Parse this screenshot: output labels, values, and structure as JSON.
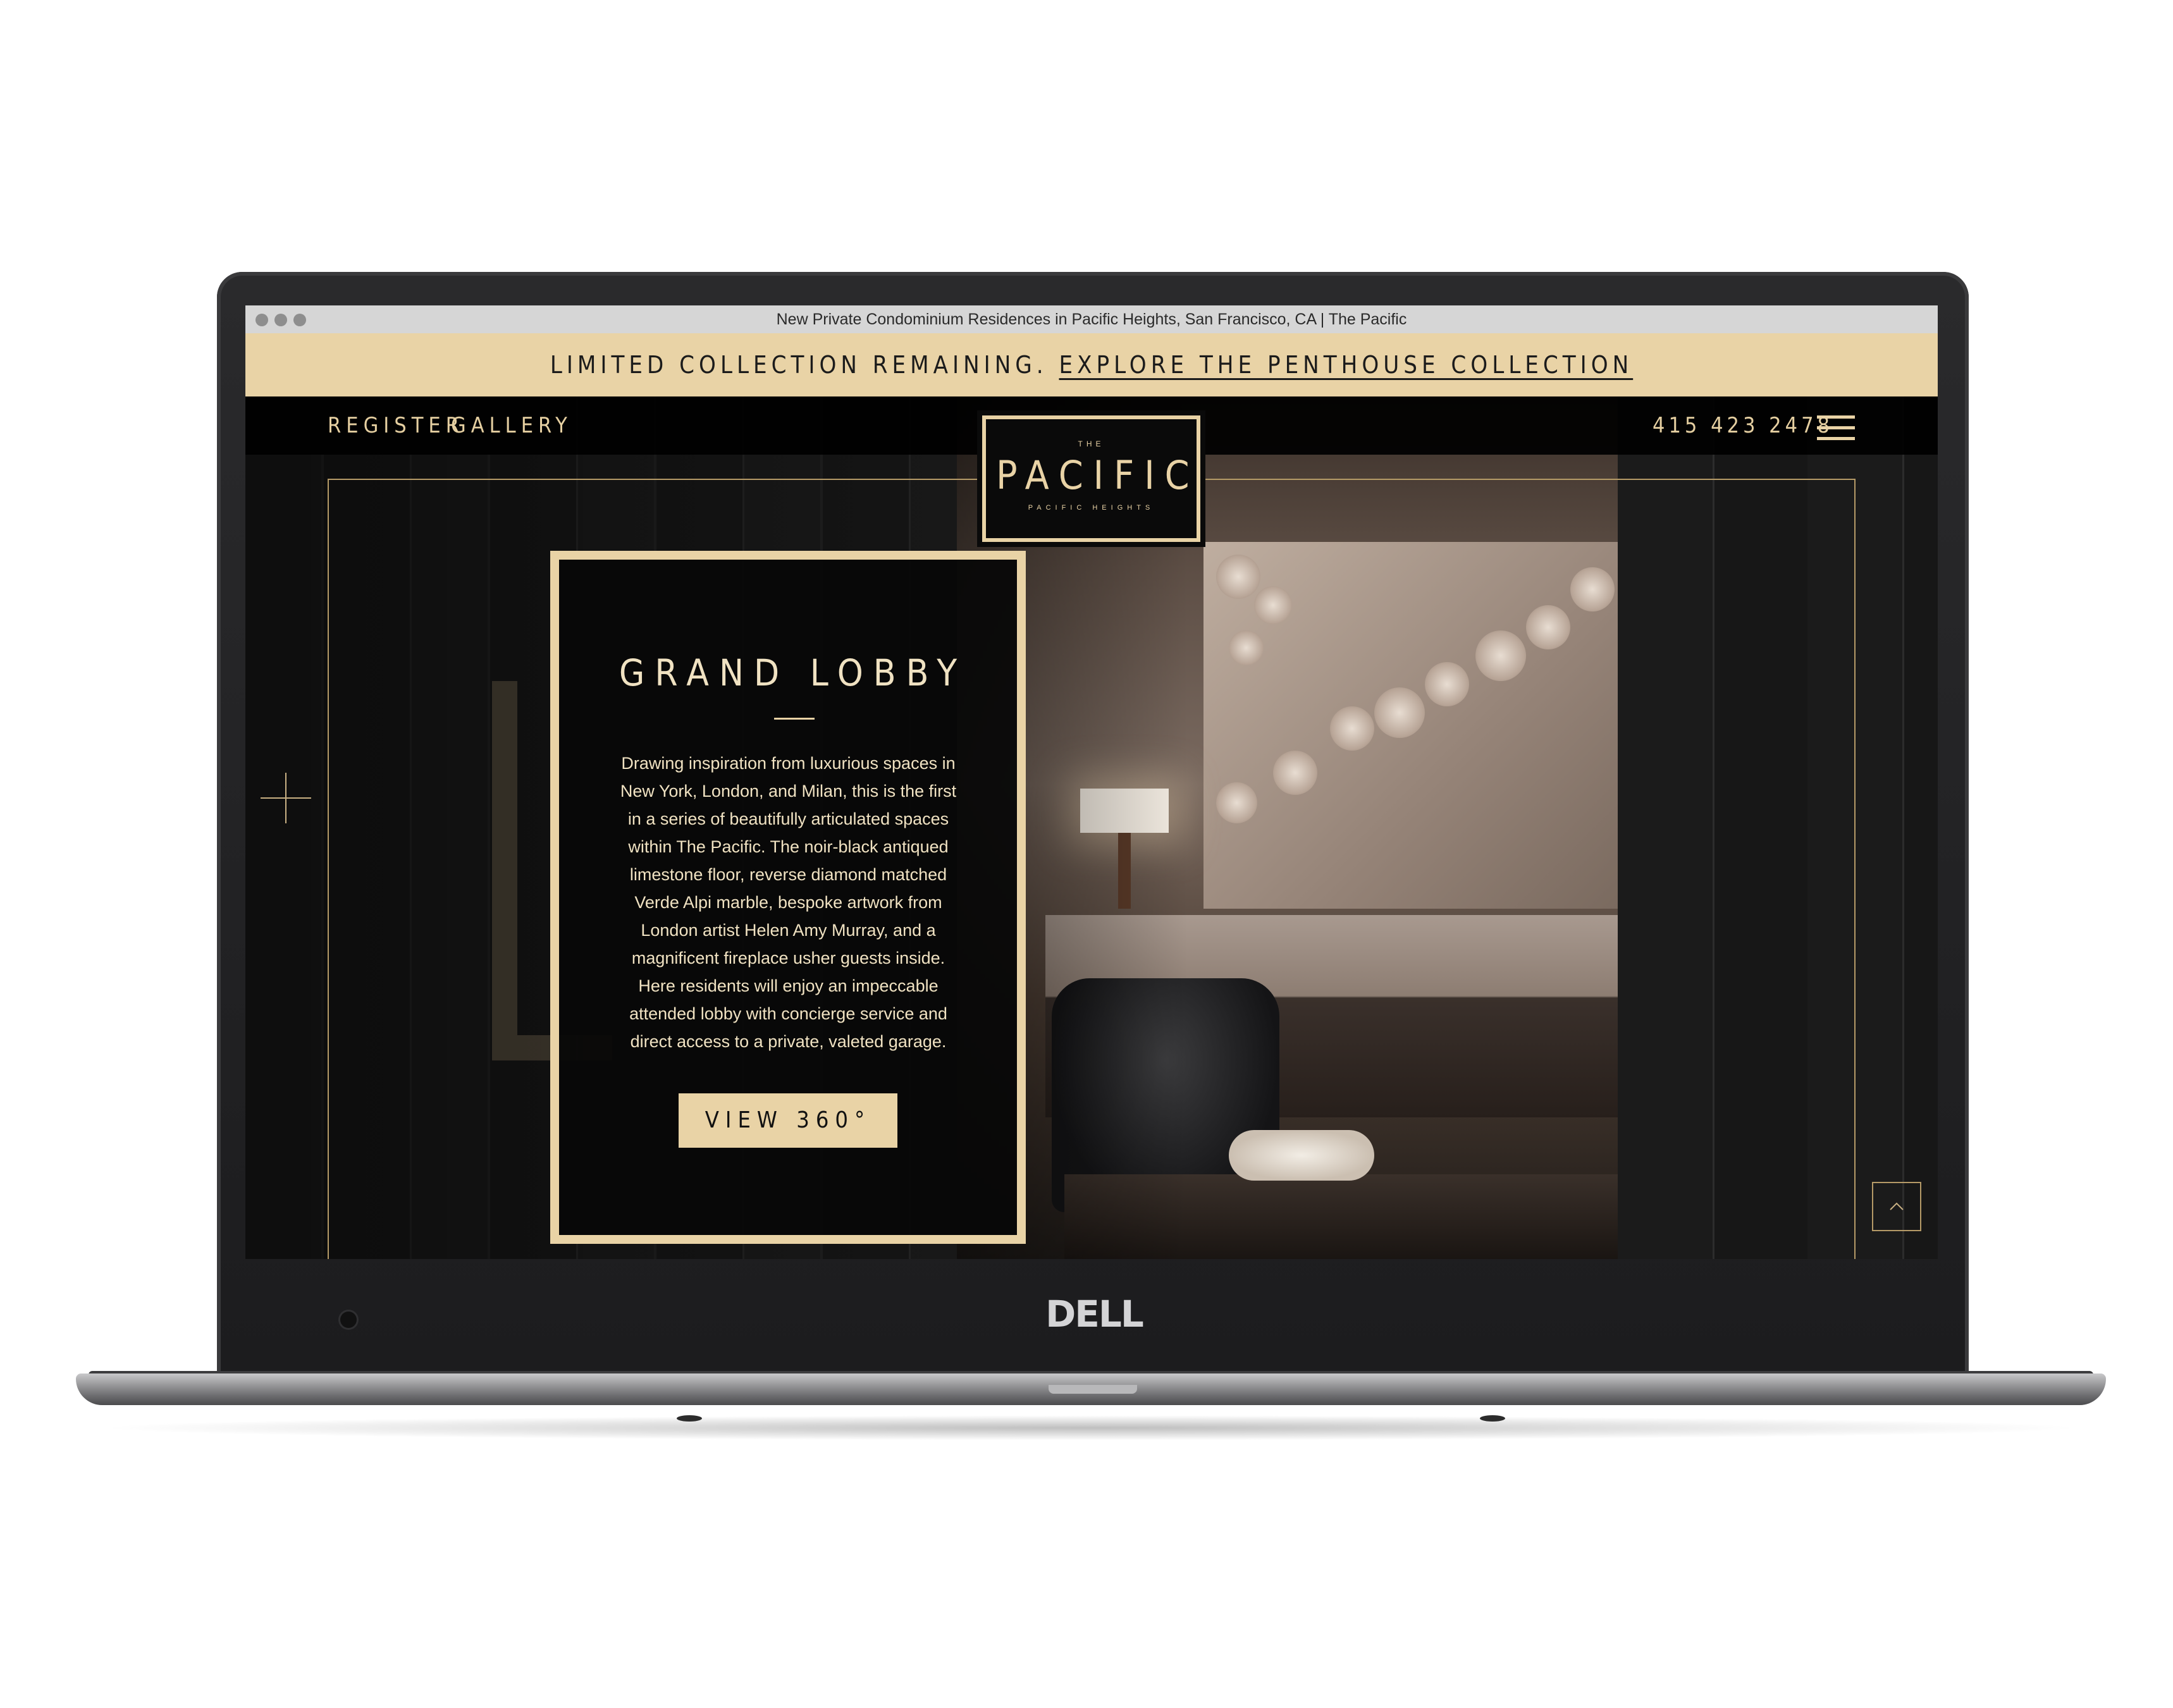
{
  "browser": {
    "window_title": "New Private Condominium Residences in Pacific Heights, San Francisco, CA | The Pacific"
  },
  "banner": {
    "text": "LIMITED COLLECTION REMAINING.",
    "link": "EXPLORE THE PENTHOUSE COLLECTION"
  },
  "nav": {
    "register": "REGISTER",
    "gallery": "GALLERY",
    "phone": "415 423 2478"
  },
  "logo": {
    "the": "THE",
    "main": "PACIFIC",
    "sub": "PACIFIC HEIGHTS"
  },
  "card": {
    "title": "GRAND LOBBY",
    "body": "Drawing inspiration from luxurious spaces in New York, London, and Milan, this is the first in a series of beautifully articulated spaces within The Pacific. The noir-black antiqued limestone floor, reverse diamond matched Verde Alpi marble, bespoke artwork from London artist Helen Amy Murray, and a magnificent fireplace usher guests inside. Here residents will enjoy an impeccable attended lobby with concierge service and direct access to a private, valeted garage.",
    "button": "VIEW 360°"
  },
  "device": {
    "brand": "DELL"
  },
  "colors": {
    "gold": "#e9d3a6",
    "frame_gold": "#b59a67",
    "dark": "#0a0a0a"
  },
  "icons": [
    "menu-icon",
    "plus-icon",
    "chevron-up-icon",
    "window-close-icon",
    "window-minimize-icon",
    "window-zoom-icon"
  ]
}
